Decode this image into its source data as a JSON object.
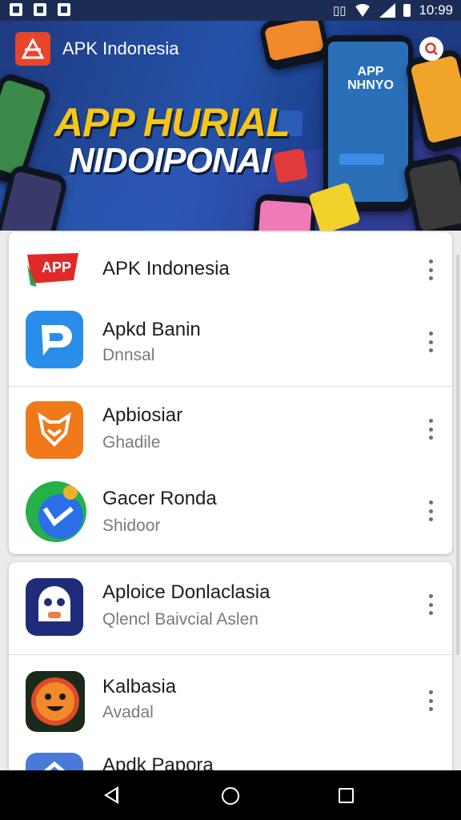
{
  "status_bar": {
    "time": "10:99",
    "icons": [
      "image-notification-icon",
      "check-notification-icon",
      "message-notification-icon",
      "vibrate-icon",
      "wifi-icon",
      "signal-icon",
      "battery-icon"
    ]
  },
  "header": {
    "title": "APK Indonesia",
    "logo_icon": "apk-logo-icon",
    "search_icon": "search-icon"
  },
  "banner": {
    "headline_line1": "APP HURIAL",
    "headline_line2": "NIDOIPONAI",
    "promo_text": "APP\nNHNYO"
  },
  "list": {
    "sections": [
      {
        "items": [
          {
            "name": "APK Indonesia",
            "subtitle": "",
            "icon": "app-brand-icon",
            "color": "#e02a2a"
          },
          {
            "name": "Apkd Banin",
            "subtitle": "Dnnsal",
            "icon": "p-app-icon",
            "color": "#2a8ee8"
          },
          {
            "name": "Apbiosiar",
            "subtitle": "Ghadile",
            "icon": "fox-shield-icon",
            "color": "#f07a1a"
          },
          {
            "name": "Gacer Ronda",
            "subtitle": "Shidoor",
            "icon": "chat-badge-icon",
            "color": "#25b04a"
          }
        ]
      },
      {
        "items": [
          {
            "name": "Aploice Donlaclasia",
            "subtitle": "Qlencl Baivcial Aslen",
            "icon": "ghost-face-icon",
            "color": "#1f2c7a"
          },
          {
            "name": "Kalbasia",
            "subtitle": "Avadal",
            "icon": "smiley-face-icon",
            "color": "#e0601a"
          },
          {
            "name": "Apdk Papora",
            "subtitle": "",
            "icon": "arrow-app-icon",
            "color": "#4a7ad8"
          }
        ]
      }
    ],
    "more_icon": "more-vertical-icon"
  },
  "nav": {
    "back": "back-icon",
    "home": "home-icon",
    "recent": "recents-icon"
  }
}
